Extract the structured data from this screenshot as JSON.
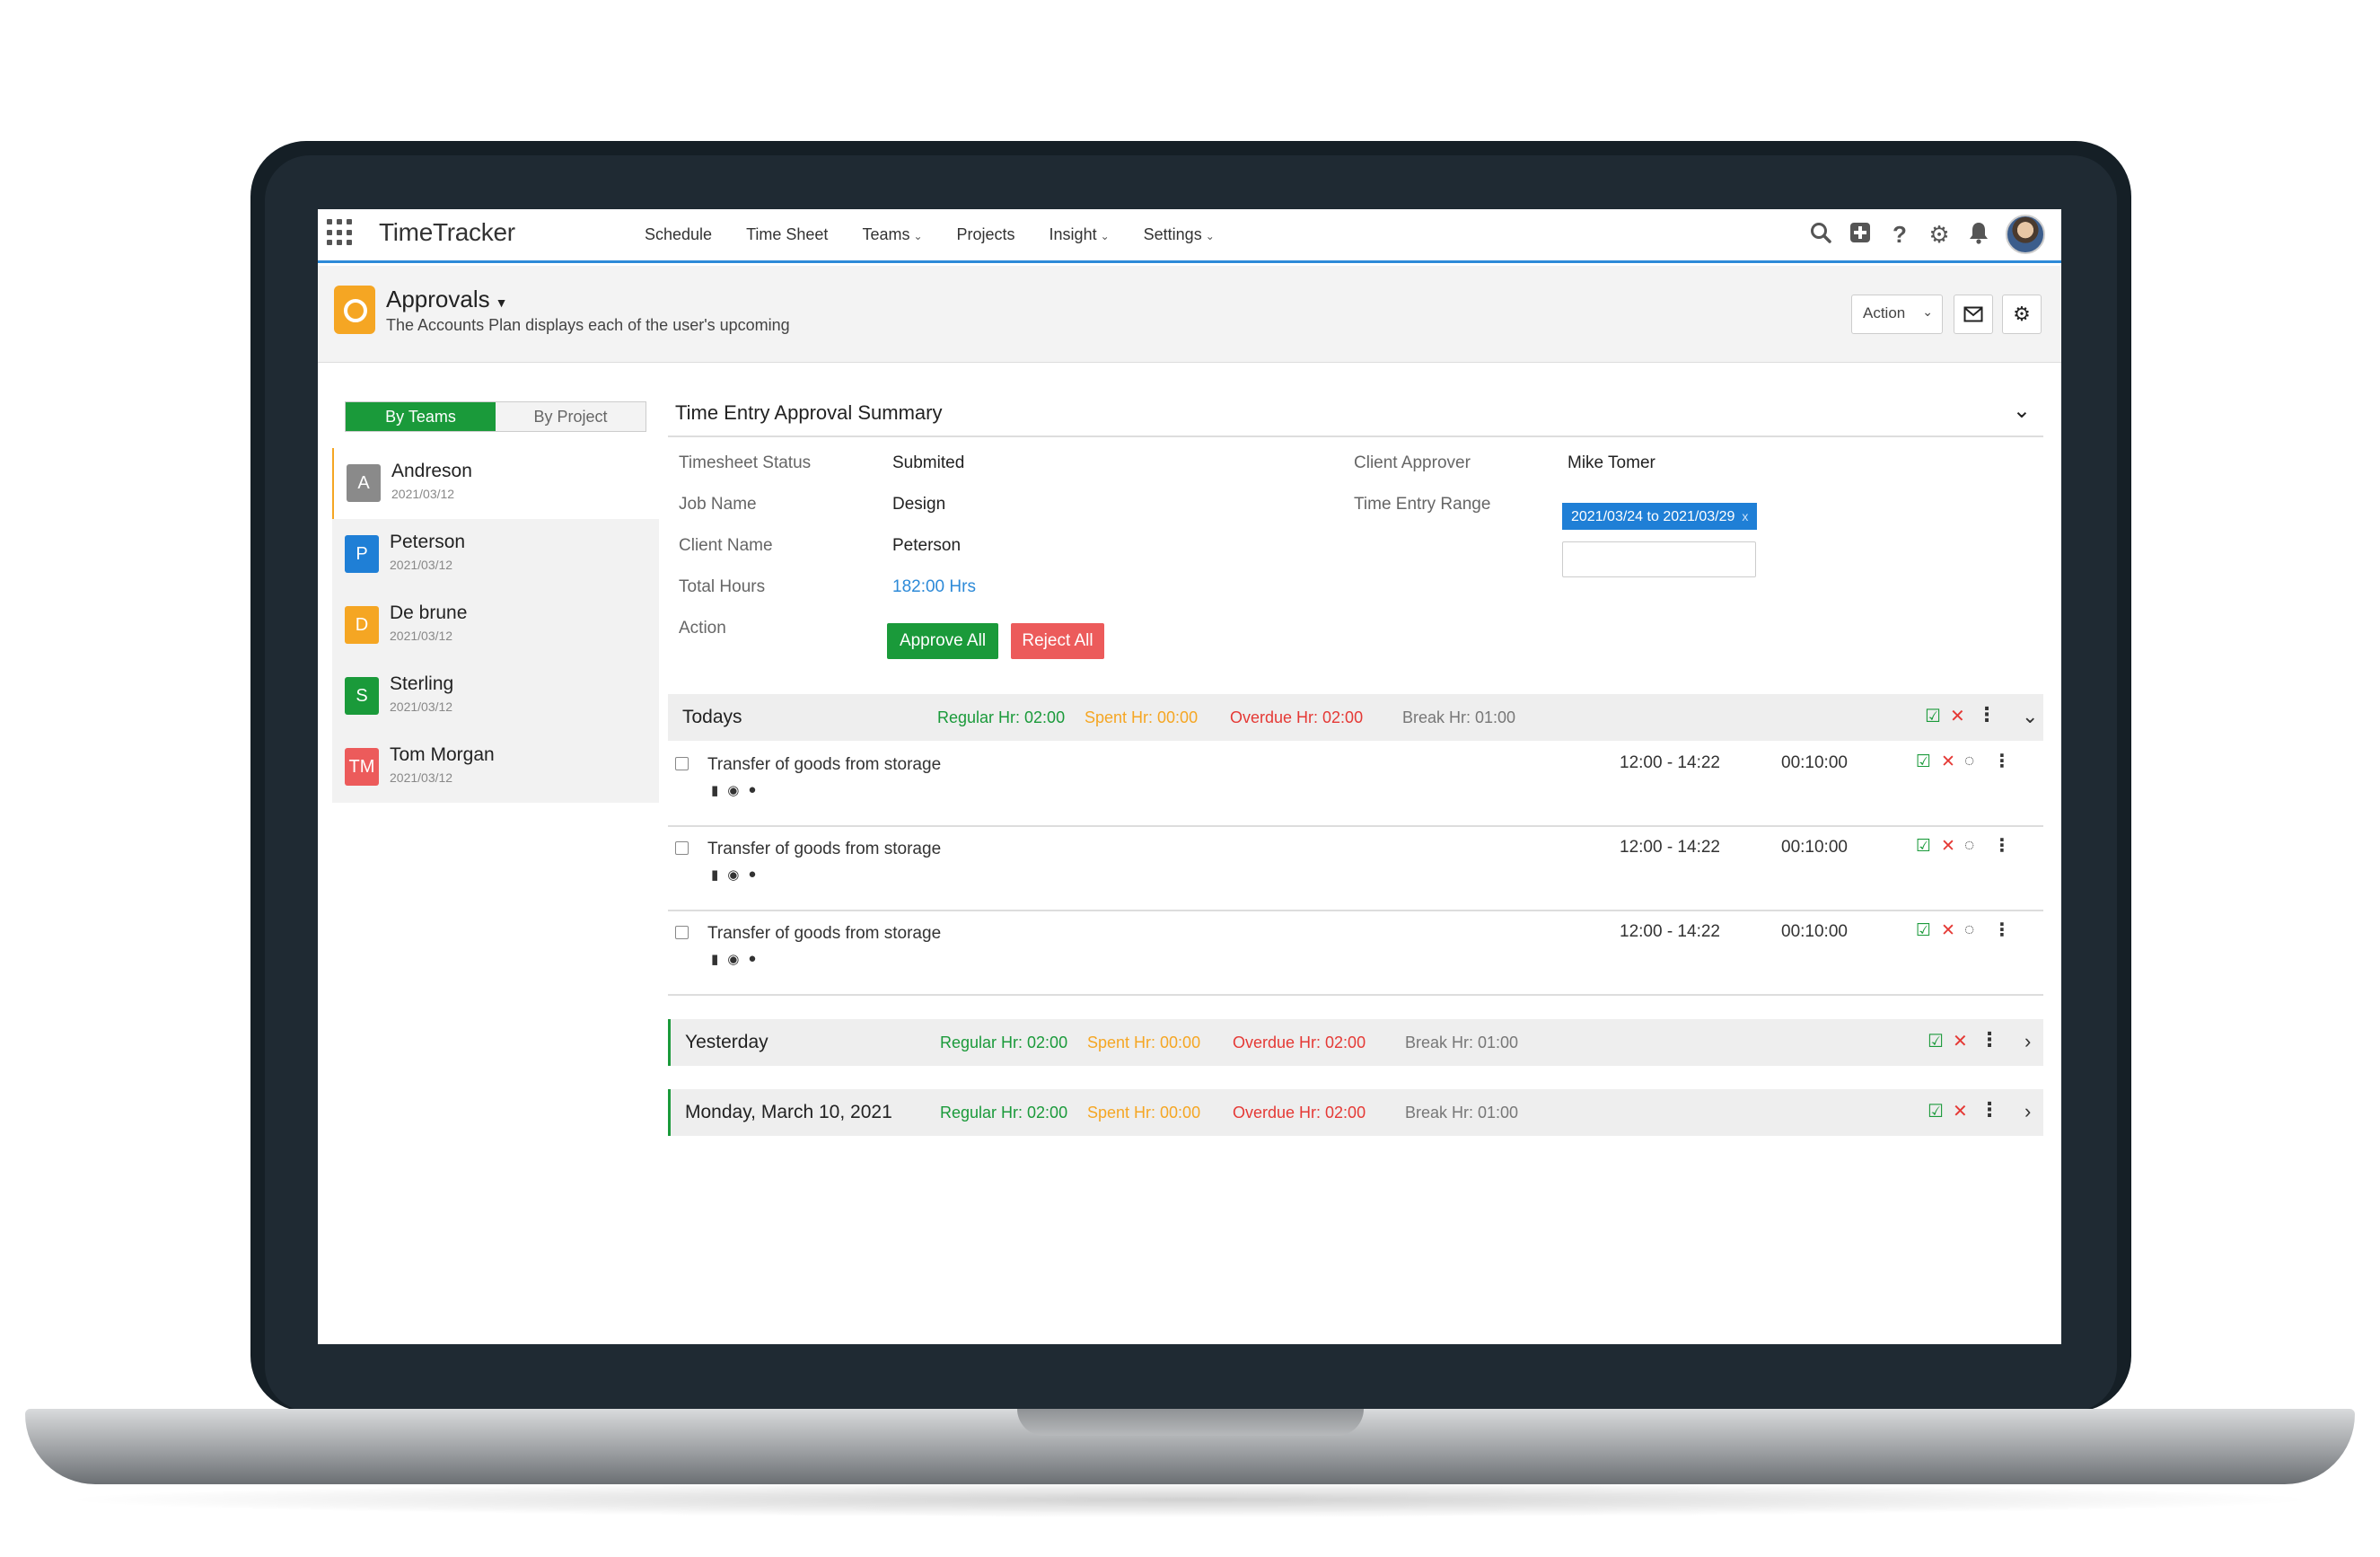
{
  "app": {
    "name": "TimeTracker",
    "nav": [
      {
        "label": "Schedule",
        "dropdown": false
      },
      {
        "label": "Time Sheet",
        "dropdown": false
      },
      {
        "label": "Teams",
        "dropdown": true
      },
      {
        "label": "Projects",
        "dropdown": false
      },
      {
        "label": "Insight",
        "dropdown": true
      },
      {
        "label": "Settings",
        "dropdown": true
      }
    ],
    "icons": [
      "search-icon",
      "add-icon",
      "help-icon",
      "gear-icon",
      "bell-icon",
      "user-avatar"
    ]
  },
  "header": {
    "title": "Approvals",
    "subtitle": "The Accounts Plan displays each of the user's upcoming",
    "action_label": "Action"
  },
  "sidebar": {
    "tabs": [
      {
        "label": "By Teams",
        "active": true
      },
      {
        "label": "By Project",
        "active": false
      }
    ],
    "people": [
      {
        "initials": "A",
        "name": "Andreson",
        "date": "2021/03/12",
        "color": "#8a8a8a",
        "selected": true
      },
      {
        "initials": "P",
        "name": "Peterson",
        "date": "2021/03/12",
        "color": "#1f7fd6",
        "selected": false
      },
      {
        "initials": "D",
        "name": "De brune",
        "date": "2021/03/12",
        "color": "#f5a623",
        "selected": false
      },
      {
        "initials": "S",
        "name": "Sterling",
        "date": "2021/03/12",
        "color": "#1a9a3a",
        "selected": false
      },
      {
        "initials": "TM",
        "name": "Tom Morgan",
        "date": "2021/03/12",
        "color": "#ec5b5b",
        "selected": false
      }
    ]
  },
  "summary": {
    "title": "Time Entry Approval Summary",
    "fields": {
      "timesheet_status_label": "Timesheet Status",
      "timesheet_status": "Submited",
      "job_name_label": "Job Name",
      "job_name": "Design",
      "client_name_label": "Client Name",
      "client_name": "Peterson",
      "total_hours_label": "Total Hours",
      "total_hours": "182:00 Hrs",
      "action_label": "Action",
      "client_approver_label": "Client Approver",
      "client_approver": "Mike Tomer",
      "time_entry_range_label": "Time Entry Range",
      "time_entry_range": "2021/03/24 to 2021/03/29"
    },
    "approve_all": "Approve All",
    "reject_all": "Reject All"
  },
  "groups": [
    {
      "title": "Todays",
      "regular": "Regular Hr: 02:00",
      "spent": "Spent Hr: 00:00",
      "overdue": "Overdue Hr: 02:00",
      "break": "Break Hr: 01:00",
      "expanded": true,
      "entries": [
        {
          "title": "Transfer of goods from storage",
          "time": "12:00 - 14:22",
          "duration": "00:10:00"
        },
        {
          "title": "Transfer of goods from storage",
          "time": "12:00 - 14:22",
          "duration": "00:10:00"
        },
        {
          "title": "Transfer of goods from storage",
          "time": "12:00 - 14:22",
          "duration": "00:10:00"
        }
      ]
    },
    {
      "title": "Yesterday",
      "regular": "Regular Hr: 02:00",
      "spent": "Spent Hr: 00:00",
      "overdue": "Overdue Hr: 02:00",
      "break": "Break Hr: 01:00",
      "expanded": false
    },
    {
      "title": "Monday, March 10, 2021",
      "regular": "Regular Hr: 02:00",
      "spent": "Spent Hr: 00:00",
      "overdue": "Overdue Hr: 02:00",
      "break": "Break Hr: 01:00",
      "expanded": false
    }
  ],
  "colors": {
    "accent": "#2d8ad8",
    "approve": "#1a9a3a",
    "reject": "#ec5b5b",
    "spent": "#f5a623",
    "overdue": "#e53935"
  }
}
